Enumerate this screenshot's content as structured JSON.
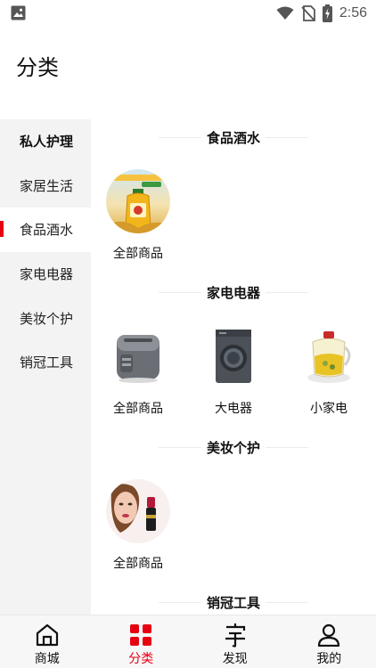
{
  "status_bar": {
    "time": "2:56"
  },
  "header": {
    "title": "分类"
  },
  "sidebar": {
    "items": [
      {
        "label": "私人护理"
      },
      {
        "label": "家居生活"
      },
      {
        "label": "食品酒水"
      },
      {
        "label": "家电电器"
      },
      {
        "label": "美妆个护"
      },
      {
        "label": "销冠工具"
      }
    ]
  },
  "sections": [
    {
      "title": "食品酒水",
      "tiles": [
        {
          "label": "全部商品",
          "icon": "oil-bottle-image"
        }
      ]
    },
    {
      "title": "家电电器",
      "tiles": [
        {
          "label": "全部商品",
          "icon": "rice-cooker-image"
        },
        {
          "label": "大电器",
          "icon": "washing-machine-image"
        },
        {
          "label": "小家电",
          "icon": "kettle-image"
        }
      ]
    },
    {
      "title": "美妆个护",
      "tiles": [
        {
          "label": "全部商品",
          "icon": "lipstick-model-image"
        }
      ]
    },
    {
      "title": "销冠工具",
      "tiles": []
    }
  ],
  "bottom_nav": [
    {
      "label": "商城",
      "icon": "home-icon"
    },
    {
      "label": "分类",
      "icon": "grid-icon"
    },
    {
      "label": "发现",
      "icon": "discover-icon"
    },
    {
      "label": "我的",
      "icon": "profile-icon"
    }
  ],
  "colors": {
    "accent": "#e60012",
    "sidebar_bg": "#f3f3f3",
    "nav_bg": "#f7f7f7"
  }
}
